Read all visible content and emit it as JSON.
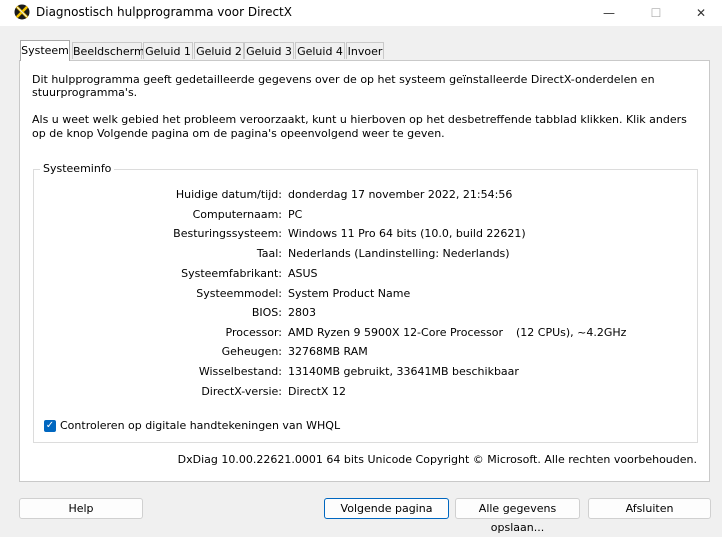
{
  "window": {
    "title": "Diagnostisch hulpprogramma voor DirectX",
    "minimize": "—",
    "maximize": "☐",
    "close": "✕"
  },
  "tabs": [
    {
      "label": "Systeem",
      "active": true
    },
    {
      "label": "Beeldscherm"
    },
    {
      "label": "Geluid 1"
    },
    {
      "label": "Geluid 2"
    },
    {
      "label": "Geluid 3"
    },
    {
      "label": "Geluid 4"
    },
    {
      "label": "Invoer"
    }
  ],
  "intro": {
    "line1": "Dit hulpprogramma geeft gedetailleerde gegevens over de op het systeem geïnstalleerde DirectX-onderdelen en stuurprogramma's.",
    "line2": "Als u weet welk gebied het probleem veroorzaakt, kunt u hierboven op het desbetreffende tabblad klikken. Klik anders op de knop Volgende pagina om de pagina's opeenvolgend weer te geven."
  },
  "sysinfo": {
    "title": "Systeeminfo",
    "rows": [
      {
        "label": "Huidige datum/tijd:",
        "value": "donderdag 17 november 2022, 21:54:56"
      },
      {
        "label": "Computernaam:",
        "value": "PC"
      },
      {
        "label": "Besturingssysteem:",
        "value": "Windows 11 Pro 64 bits (10.0, build 22621)"
      },
      {
        "label": "Taal:",
        "value": "Nederlands (Landinstelling: Nederlands)"
      },
      {
        "label": "Systeemfabrikant:",
        "value": "ASUS"
      },
      {
        "label": "Systeemmodel:",
        "value": "System Product Name"
      },
      {
        "label": "BIOS:",
        "value": "2803"
      },
      {
        "label": "Processor:",
        "value": "AMD Ryzen 9 5900X 12-Core Processor",
        "extra": "(12 CPUs), ~4.2GHz"
      },
      {
        "label": "Geheugen:",
        "value": "32768MB RAM"
      },
      {
        "label": "Wisselbestand:",
        "value": "13140MB gebruikt, 33641MB beschikbaar"
      },
      {
        "label": "DirectX-versie:",
        "value": "DirectX 12"
      }
    ],
    "whql_label": "Controleren op digitale handtekeningen van WHQL",
    "whql_checked": true,
    "checkmark": "✓"
  },
  "footer_info": "DxDiag 10.00.22621.0001 64 bits Unicode  Copyright © Microsoft.  Alle rechten voorbehouden.",
  "buttons": {
    "help": "Help",
    "next": "Volgende pagina",
    "save": "Alle gegevens opslaan...",
    "exit": "Afsluiten"
  },
  "colors": {
    "accent": "#0067c0"
  }
}
